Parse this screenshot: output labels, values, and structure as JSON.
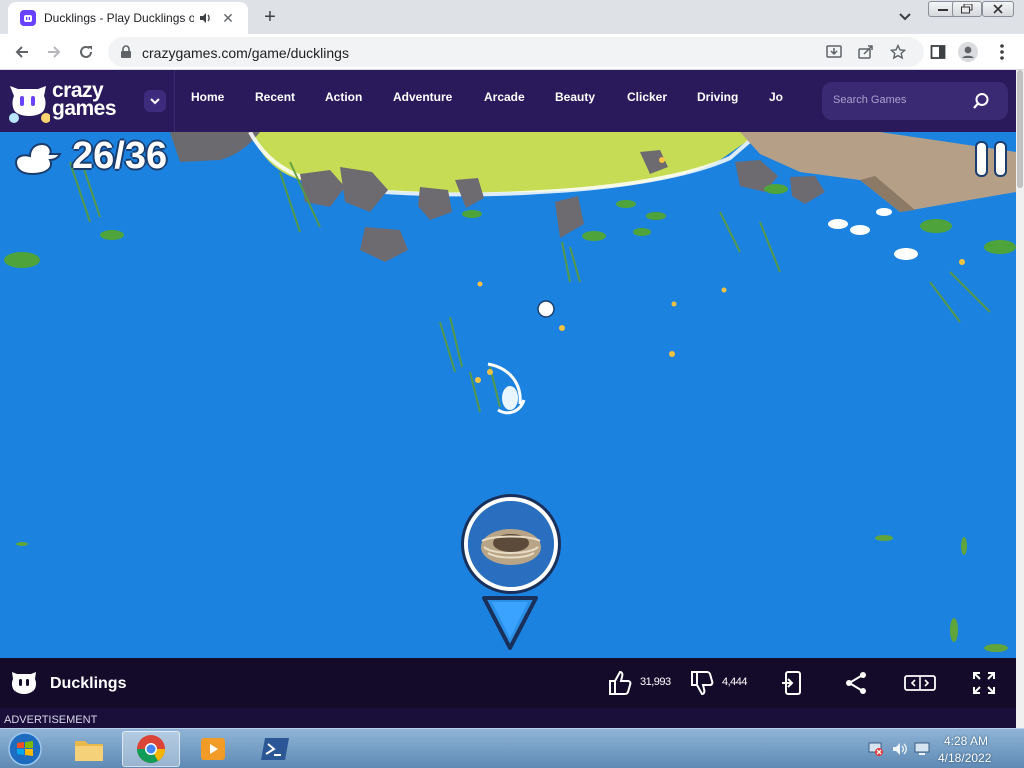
{
  "browser": {
    "tab": {
      "title": "Ducklings - Play Ducklings o",
      "favicon": "crazygames-favicon-icon",
      "audio_icon": "speaker-icon",
      "close_icon": "close-icon"
    },
    "new_tab_icon": "plus-icon",
    "url": "crazygames.com/game/ducklings",
    "toolbar_icons": [
      "back-icon",
      "forward-icon",
      "reload-icon",
      "lock-icon",
      "install-icon",
      "share-icon",
      "bookmark-star-icon",
      "side-panel-icon",
      "profile-icon",
      "kebab-menu-icon"
    ]
  },
  "site": {
    "logo": {
      "line1": "crazy",
      "line2": "games"
    },
    "nav": [
      "Home",
      "Recent",
      "Action",
      "Adventure",
      "Arcade",
      "Beauty",
      "Clicker",
      "Driving",
      "Jo"
    ],
    "search_placeholder": "Search Games"
  },
  "game": {
    "counter": "26/36",
    "pause_icon": "pause-icon",
    "nest_icon": "nest-icon",
    "arrow_icon": "down-arrow-icon"
  },
  "gamebar": {
    "title": "Ducklings",
    "likes": "31,993",
    "dislikes": "4,444",
    "icons": [
      "thumbs-up-icon",
      "thumbs-down-icon",
      "report-icon",
      "share-icon",
      "theater-mode-icon",
      "fullscreen-icon"
    ]
  },
  "ad_label": "ADVERTISEMENT",
  "taskbar": {
    "apps": [
      "file-explorer-icon",
      "chrome-icon",
      "media-player-icon",
      "powershell-icon"
    ],
    "time": "4:28 AM",
    "date": "4/18/2022",
    "tray": [
      "network-warning-icon",
      "volume-icon",
      "display-icon"
    ]
  },
  "colors": {
    "header": "#2a1a5c",
    "water": "#1c82e0",
    "gamebar": "#130b29",
    "accent": "#6842ff"
  }
}
